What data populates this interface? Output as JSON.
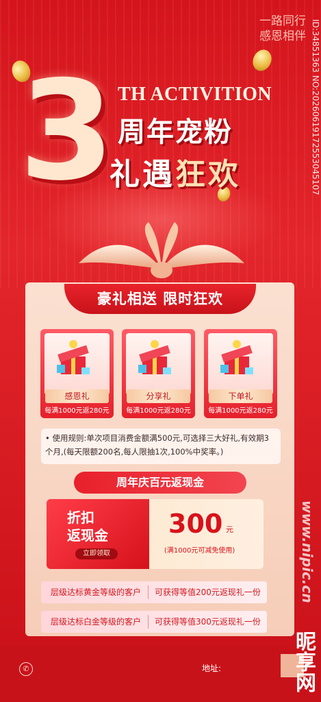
{
  "header": {
    "slogan_line1": "一路同行",
    "slogan_line2": "感恩相伴",
    "big_number": "3",
    "subtitle_en": "TH ACTIVITION",
    "title_line1": "周年宠粉",
    "title_line2a": "礼遇",
    "title_line2b": "狂欢",
    "side_id": "ID:34851363 NO:20260619172553045107"
  },
  "panel": {
    "ribbon_title": "豪礼相送 限时狂欢",
    "gifts": [
      {
        "label": "感恩礼",
        "caption": "每满1000元返280元"
      },
      {
        "label": "分享礼",
        "caption": "每满1000元返280元"
      },
      {
        "label": "下单礼",
        "caption": "每满1000元返280元"
      }
    ],
    "rules_text": "• 使用规则:单次项目消费金额满500元,可选择三大好礼,有效期3个月,(每天限额200名,每人限抽1次,100%中奖率。)",
    "cashback_pill": "周年庆百元返现金",
    "coupon": {
      "title_line1": "折扣",
      "title_line2": "返现金",
      "button": "立即领取",
      "value": "300",
      "unit": "元",
      "condition": "(满1000元可减免使用)"
    },
    "tiers": [
      {
        "left": "层级达标黄金等级的客户",
        "right": "可获得等值200元返现礼一份"
      },
      {
        "left": "层级达标白金等级的客户",
        "right": "可获得等值300元返现礼一份"
      }
    ]
  },
  "footer": {
    "address_label": "地址:",
    "phone_icon": "phone-icon"
  },
  "watermark": {
    "site": "www.nipic.cn",
    "brand": "昵享网"
  },
  "colors": {
    "primary_red": "#d4141c",
    "accent_gold": "#ffe2b5",
    "panel_bg": "#fbe0d1"
  }
}
